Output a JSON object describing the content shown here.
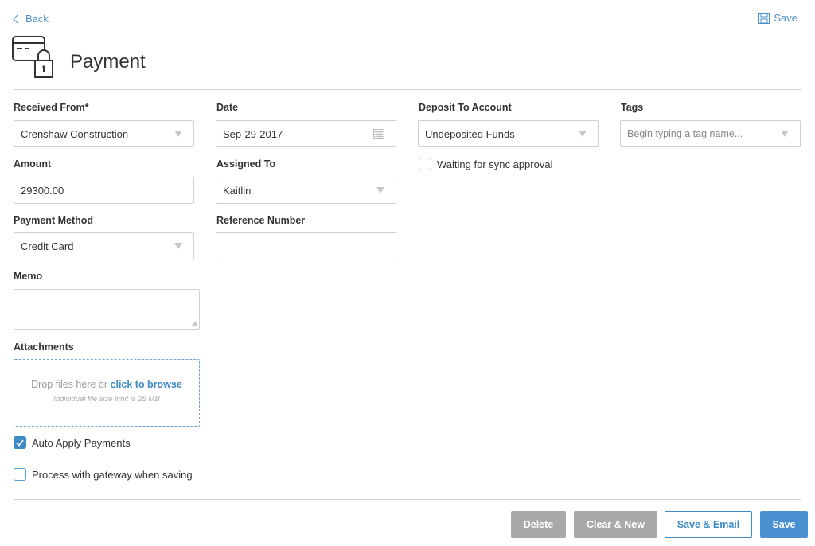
{
  "nav": {
    "back_label": "Back",
    "save_label": "Save"
  },
  "page": {
    "title": "Payment",
    "icon": "credit-card-lock-icon"
  },
  "form": {
    "received_from": {
      "label": "Received From*",
      "value": "Crenshaw Construction"
    },
    "date": {
      "label": "Date",
      "value": "Sep-29-2017"
    },
    "deposit_to_account": {
      "label": "Deposit To Account",
      "value": "Undeposited Funds"
    },
    "tags": {
      "label": "Tags",
      "placeholder": "Begin typing a tag name..."
    },
    "amount": {
      "label": "Amount",
      "value": "29300.00"
    },
    "assigned_to": {
      "label": "Assigned To",
      "value": "Kaitlin"
    },
    "waiting_for_sync": {
      "label": "Waiting for sync approval",
      "checked": false
    },
    "payment_method": {
      "label": "Payment Method",
      "value": "Credit Card"
    },
    "reference_number": {
      "label": "Reference Number",
      "value": ""
    },
    "memo": {
      "label": "Memo",
      "value": ""
    },
    "attachments": {
      "label": "Attachments",
      "drop_text": "Drop files here or",
      "browse_text": "click to browse",
      "limit_text": "Individual file size limit is 25 MB"
    },
    "auto_apply_payments": {
      "label": "Auto Apply Payments",
      "checked": true
    },
    "process_with_gateway": {
      "label": "Process with gateway when saving",
      "checked": false
    }
  },
  "actions": {
    "delete_label": "Delete",
    "clear_new_label": "Clear & New",
    "save_email_label": "Save & Email",
    "save_label": "Save"
  },
  "colors": {
    "accent": "#3d8ac7",
    "disabled_button": "#a9a9a9",
    "border": "#cfcfcf"
  }
}
